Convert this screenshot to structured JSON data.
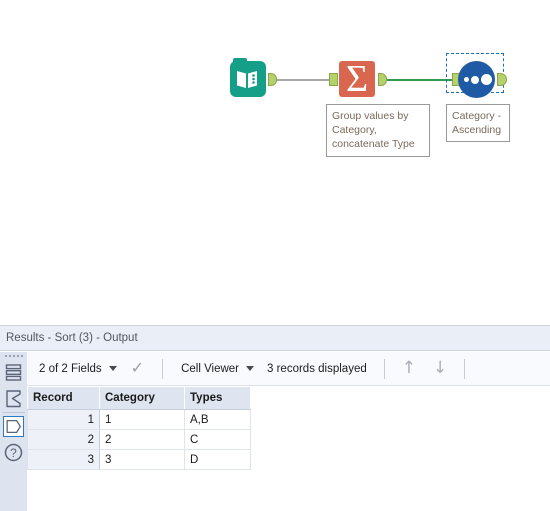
{
  "canvas": {
    "tools": [
      {
        "id": "input-data",
        "name": "Input Data",
        "icon": "book-icon",
        "color": "#159f88"
      },
      {
        "id": "summarize",
        "name": "Summarize",
        "icon": "sigma-icon",
        "glyph": "Σ",
        "color": "#d9674f"
      },
      {
        "id": "sort",
        "name": "Sort",
        "icon": "three-dots-circle-icon",
        "color": "#1f5ba4",
        "selected": true
      }
    ],
    "connections": [
      {
        "from": "input-data",
        "to": "summarize",
        "color": "#a8a8a8"
      },
      {
        "from": "summarize",
        "to": "sort",
        "color": "#2e9b4e"
      }
    ],
    "annotations": [
      {
        "for": "summarize",
        "text": "Group values by\nCategory,\nconcatenate Type"
      },
      {
        "for": "sort",
        "text": "Category -\nAscending"
      }
    ]
  },
  "results": {
    "title": "Results - Sort (3) - Output",
    "rail": {
      "items": [
        {
          "name": "messages-icon",
          "glyph": "list"
        },
        {
          "name": "summary-sigma-icon",
          "glyph": "sigma"
        },
        {
          "name": "output-tag-icon",
          "glyph": "tag",
          "selected": true
        },
        {
          "name": "help-icon",
          "glyph": "question"
        }
      ]
    },
    "toolbar": {
      "fields_label": "2 of 2 Fields",
      "check_icon": "checkmark-icon",
      "viewer_label": "Cell Viewer",
      "records_label": "3 records displayed",
      "up_arrow": "↑",
      "down_arrow": "↓"
    },
    "table": {
      "columns": [
        "Record",
        "Category",
        "Types"
      ],
      "rows": [
        {
          "record": "1",
          "category": "1",
          "types": "A,B"
        },
        {
          "record": "2",
          "category": "2",
          "types": "C"
        },
        {
          "record": "3",
          "category": "3",
          "types": "D"
        }
      ]
    }
  }
}
